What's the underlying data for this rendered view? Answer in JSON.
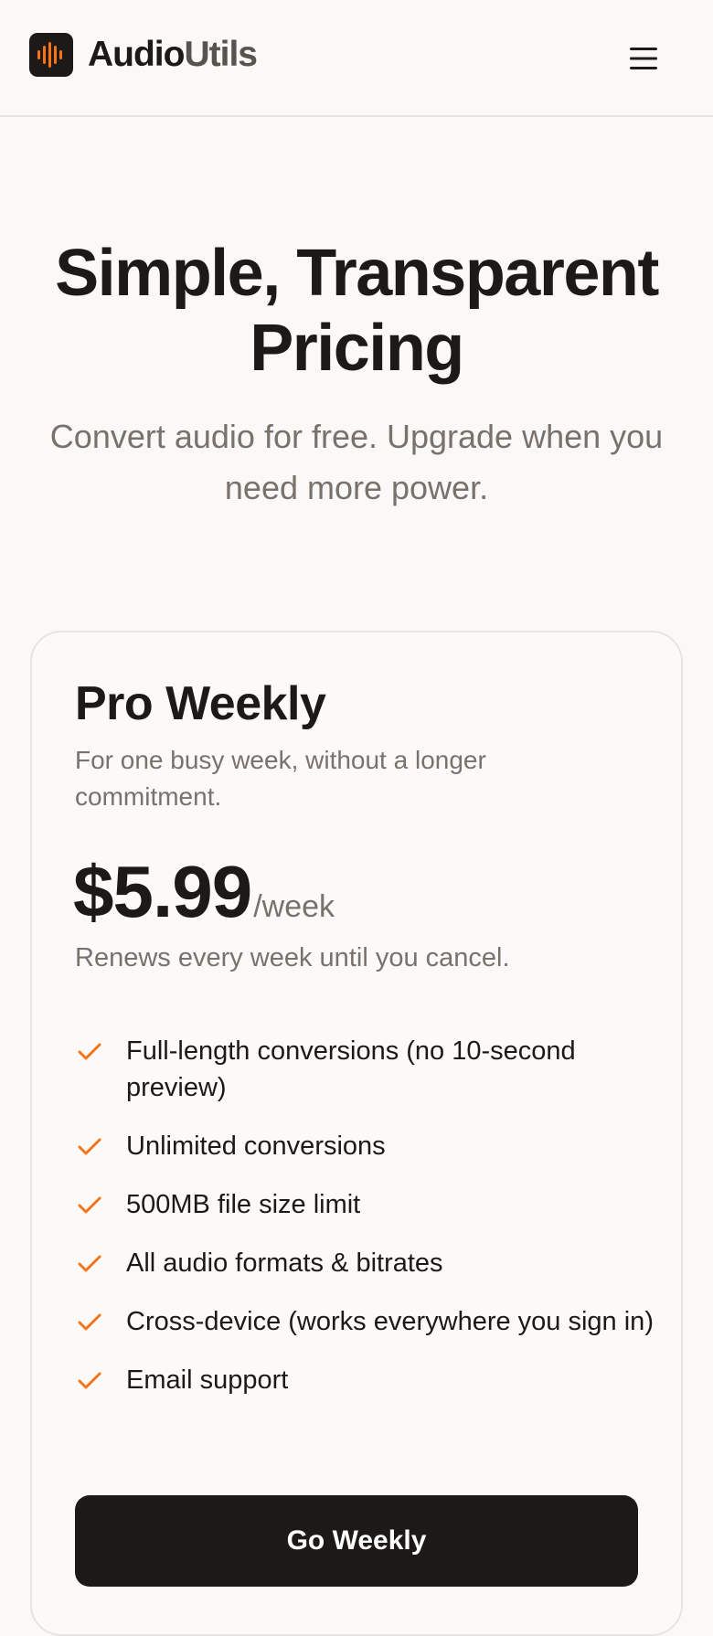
{
  "header": {
    "brand_part1": "Audio",
    "brand_part2": "Utils",
    "logo_icon": "audio-waveform-icon",
    "menu_icon": "hamburger-menu-icon",
    "accent_color": "#f97316"
  },
  "hero": {
    "title_line1": "Simple, Transparent",
    "title_line2": "Pricing",
    "subtitle": "Convert audio for free. Upgrade when you need more power."
  },
  "plan": {
    "name": "Pro Weekly",
    "description": "For one busy week, without a longer commitment.",
    "price": "$5.99",
    "period": "/week",
    "renewal": "Renews every week until you cancel.",
    "check_icon": "check-icon",
    "features": [
      "Full-length conversions (no 10-second preview)",
      "Unlimited conversions",
      "500MB file size limit",
      "All audio formats & bitrates",
      "Cross-device (works everywhere you sign in)",
      "Email support"
    ],
    "cta_label": "Go Weekly"
  }
}
